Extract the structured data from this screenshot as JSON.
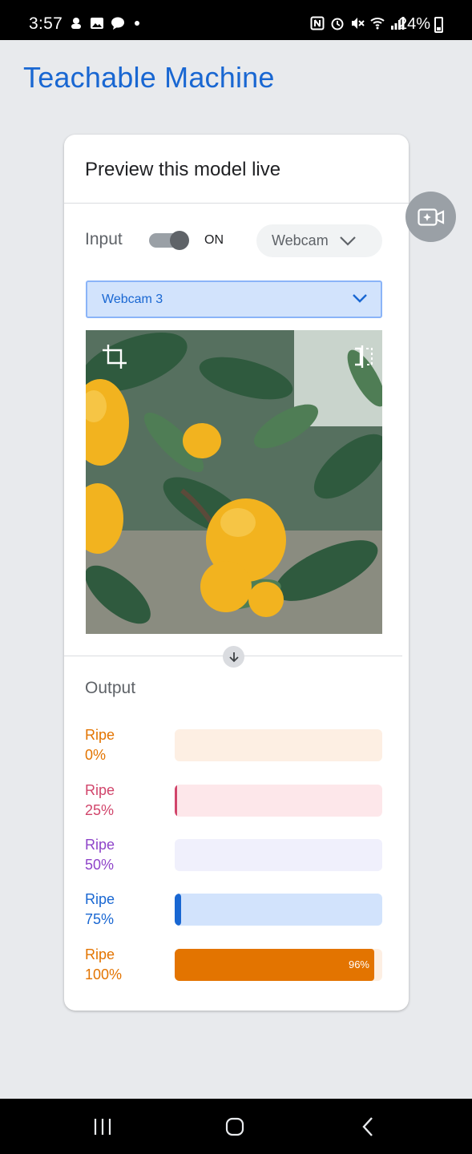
{
  "status_bar": {
    "time": "3:57",
    "battery": "24%",
    "left_icons": [
      "notification-icon",
      "gallery-icon",
      "talk-icon",
      "dot-icon"
    ],
    "right_icons": [
      "nfc-icon",
      "alarm-icon",
      "mute-icon",
      "wifi-icon",
      "signal-icon"
    ]
  },
  "app": {
    "title": "Teachable Machine"
  },
  "preview": {
    "title": "Preview this model live",
    "input_label": "Input",
    "toggle_state": "ON",
    "source_button": "Webcam",
    "camera_select": "Webcam 3",
    "output_label": "Output"
  },
  "classes": [
    {
      "name": "Ripe",
      "sub": "0%",
      "percent": 0,
      "color": "#e37400",
      "track": "#fdefe3",
      "shown": ""
    },
    {
      "name": "Ripe",
      "sub": "25%",
      "percent": 1,
      "color": "#d1456b",
      "track": "#fde7ea",
      "shown": ""
    },
    {
      "name": "Ripe",
      "sub": "50%",
      "percent": 0,
      "color": "#8e44c9",
      "track": "#f0f0fc",
      "shown": ""
    },
    {
      "name": "Ripe",
      "sub": "75%",
      "percent": 3,
      "color": "#1967d2",
      "track": "#d2e3fc",
      "shown": ""
    },
    {
      "name": "Ripe",
      "sub": "100%",
      "percent": 96,
      "color": "#e37400",
      "track": "#fdefe3",
      "shown": "96%"
    }
  ],
  "colors": {
    "brand": "#1967d2",
    "background": "#e8eaed"
  }
}
